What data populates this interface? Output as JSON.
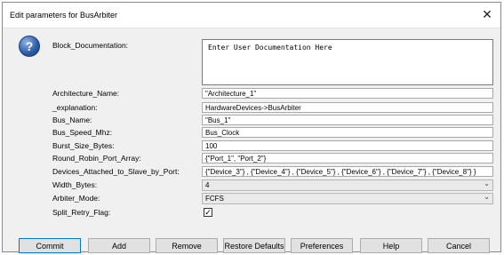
{
  "window": {
    "title": "Edit parameters for BusArbiter",
    "close_icon": "close-icon"
  },
  "icon": {
    "help_glyph": "?",
    "name": "help-icon",
    "color": "#2c5aa8"
  },
  "params": {
    "block_documentation": {
      "label": "Block_Documentation:",
      "value": "Enter User Documentation Here"
    },
    "architecture_name": {
      "label": "Architecture_Name:",
      "value": "\"Architecture_1\""
    },
    "explanation": {
      "label": "_explanation:",
      "value": "HardwareDevices->BusArbiter"
    },
    "bus_name": {
      "label": "Bus_Name:",
      "value": "\"Bus_1\""
    },
    "bus_speed": {
      "label": "Bus_Speed_Mhz:",
      "value": "Bus_Clock"
    },
    "burst_size": {
      "label": "Burst_Size_Bytes:",
      "value": "100"
    },
    "round_robin": {
      "label": "Round_Robin_Port_Array:",
      "value": "{\"Port_1\", \"Port_2\"}"
    },
    "devices_attached": {
      "label": "Devices_Attached_to_Slave_by_Port:",
      "value": "{\"Device_3\"} , {\"Device_4\"} , {\"Device_5\"} , {\"Device_6\"} , {\"Device_7\"} , {\"Device_8\"} }"
    },
    "width_bytes": {
      "label": "Width_Bytes:",
      "value": "4"
    },
    "arbiter_mode": {
      "label": "Arbiter_Mode:",
      "value": "FCFS"
    },
    "split_retry": {
      "label": "Split_Retry_Flag:",
      "checked": true,
      "check_glyph": "✓"
    }
  },
  "buttons": {
    "commit": "Commit",
    "add": "Add",
    "remove": "Remove",
    "restore_defaults": "Restore Defaults",
    "preferences": "Preferences",
    "help": "Help",
    "cancel": "Cancel"
  },
  "glyphs": {
    "chevron": "⌄",
    "close": "✕"
  }
}
